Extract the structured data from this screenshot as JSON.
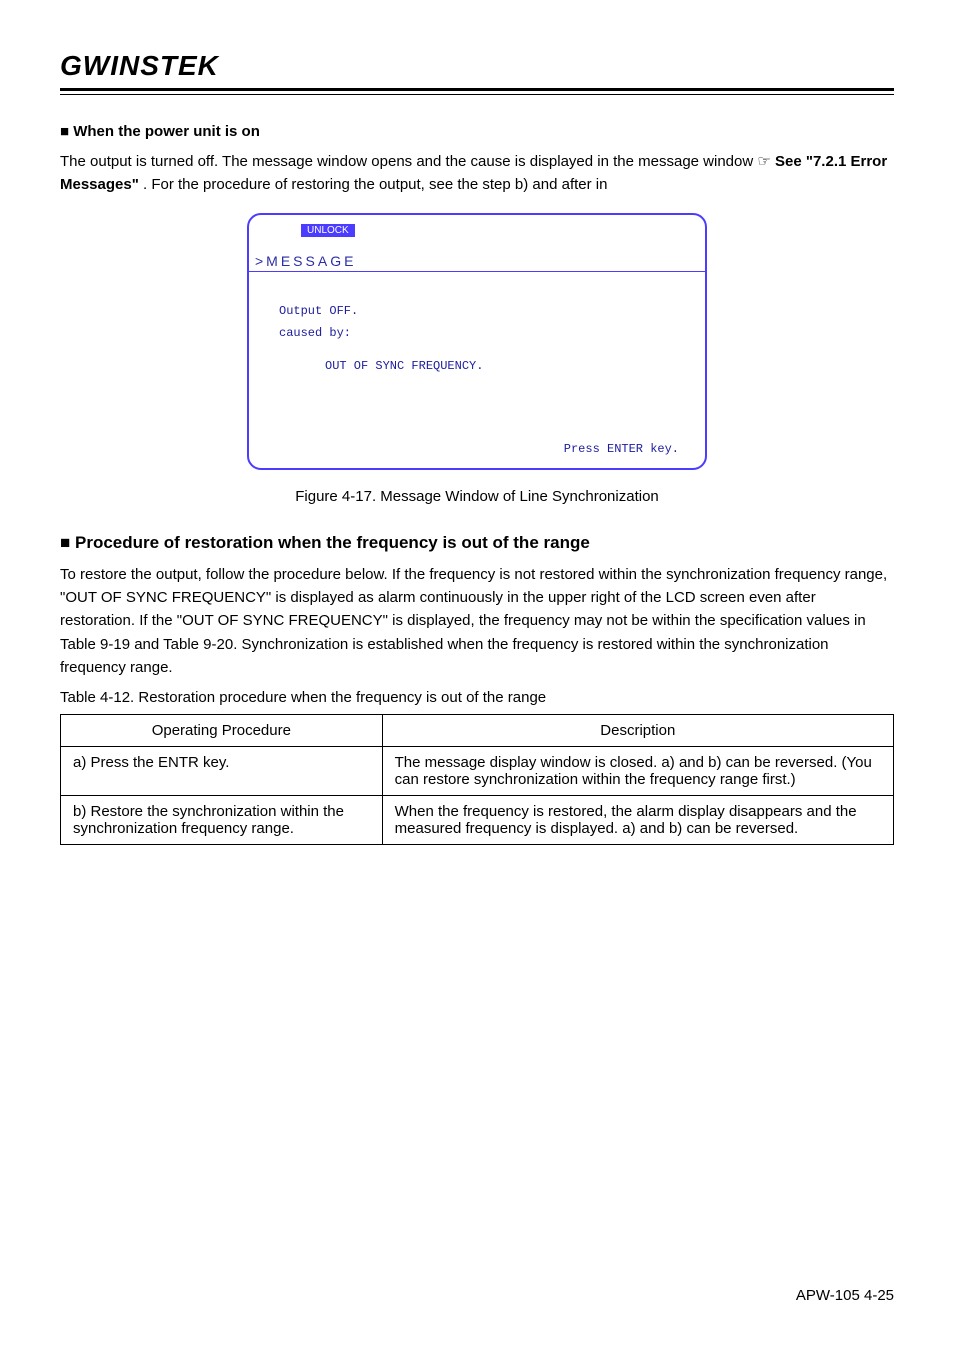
{
  "brand": "GWINSTEK",
  "power": {
    "heading": "■ When the power unit is on",
    "p1_a": "The output is turned off. The message window opens and the cause is displayed in the message window ",
    "see_icon": "☞",
    "see_label": "See \"",
    "p1_b": "7.2.1 Error Messages",
    "p1_c": "\"",
    "p1_d": " . For the procedure of restoring the output, see the step b) and after in "
  },
  "figure": {
    "unlock": "UNLOCK",
    "message": ">MESSAGE",
    "line1": "Output OFF.",
    "line2": "caused by:",
    "line3": "OUT OF SYNC FREQUENCY.",
    "footer": "Press ENTER key.",
    "caption": "Figure 4-17.    Message Window of Line Synchronization"
  },
  "restore": {
    "heading": "■ Procedure of restoration when the frequency is out of the range",
    "p1_a": "To restore the output, follow the procedure below. If the frequency is not restored within the synchronization frequency range, \"",
    "p1_b": "OUT OF SYNC FREQUENCY",
    "p1_c": "\" is displayed as alarm continuously in the upper right of the LCD screen even after restoration. If the \"",
    "p1_d": "OUT OF SYNC FREQUENCY",
    "p1_e": "\" is displayed, the frequency may not be within the specification values in Table 9-19 and Table 9-20. Synchronization is established when the frequency is restored within the synchronization frequency range.",
    "table_intro": "Table 4-12.    Restoration procedure when the frequency is out of the range"
  },
  "table": {
    "header": {
      "col1": "Operating Procedure",
      "col2": "Description"
    },
    "rows": [
      {
        "col1": "a) Press the ENTR key.",
        "col2": "The message display window is closed. a) and b) can be reversed. (You can restore synchronization within the frequency range first.)"
      },
      {
        "col1": "b) Restore the synchronization within the synchronization frequency range.",
        "col2": "When the frequency is restored, the alarm display disappears and the measured frequency is displayed. a) and b) can be reversed."
      }
    ]
  },
  "page_label": "APW-105 4-25"
}
